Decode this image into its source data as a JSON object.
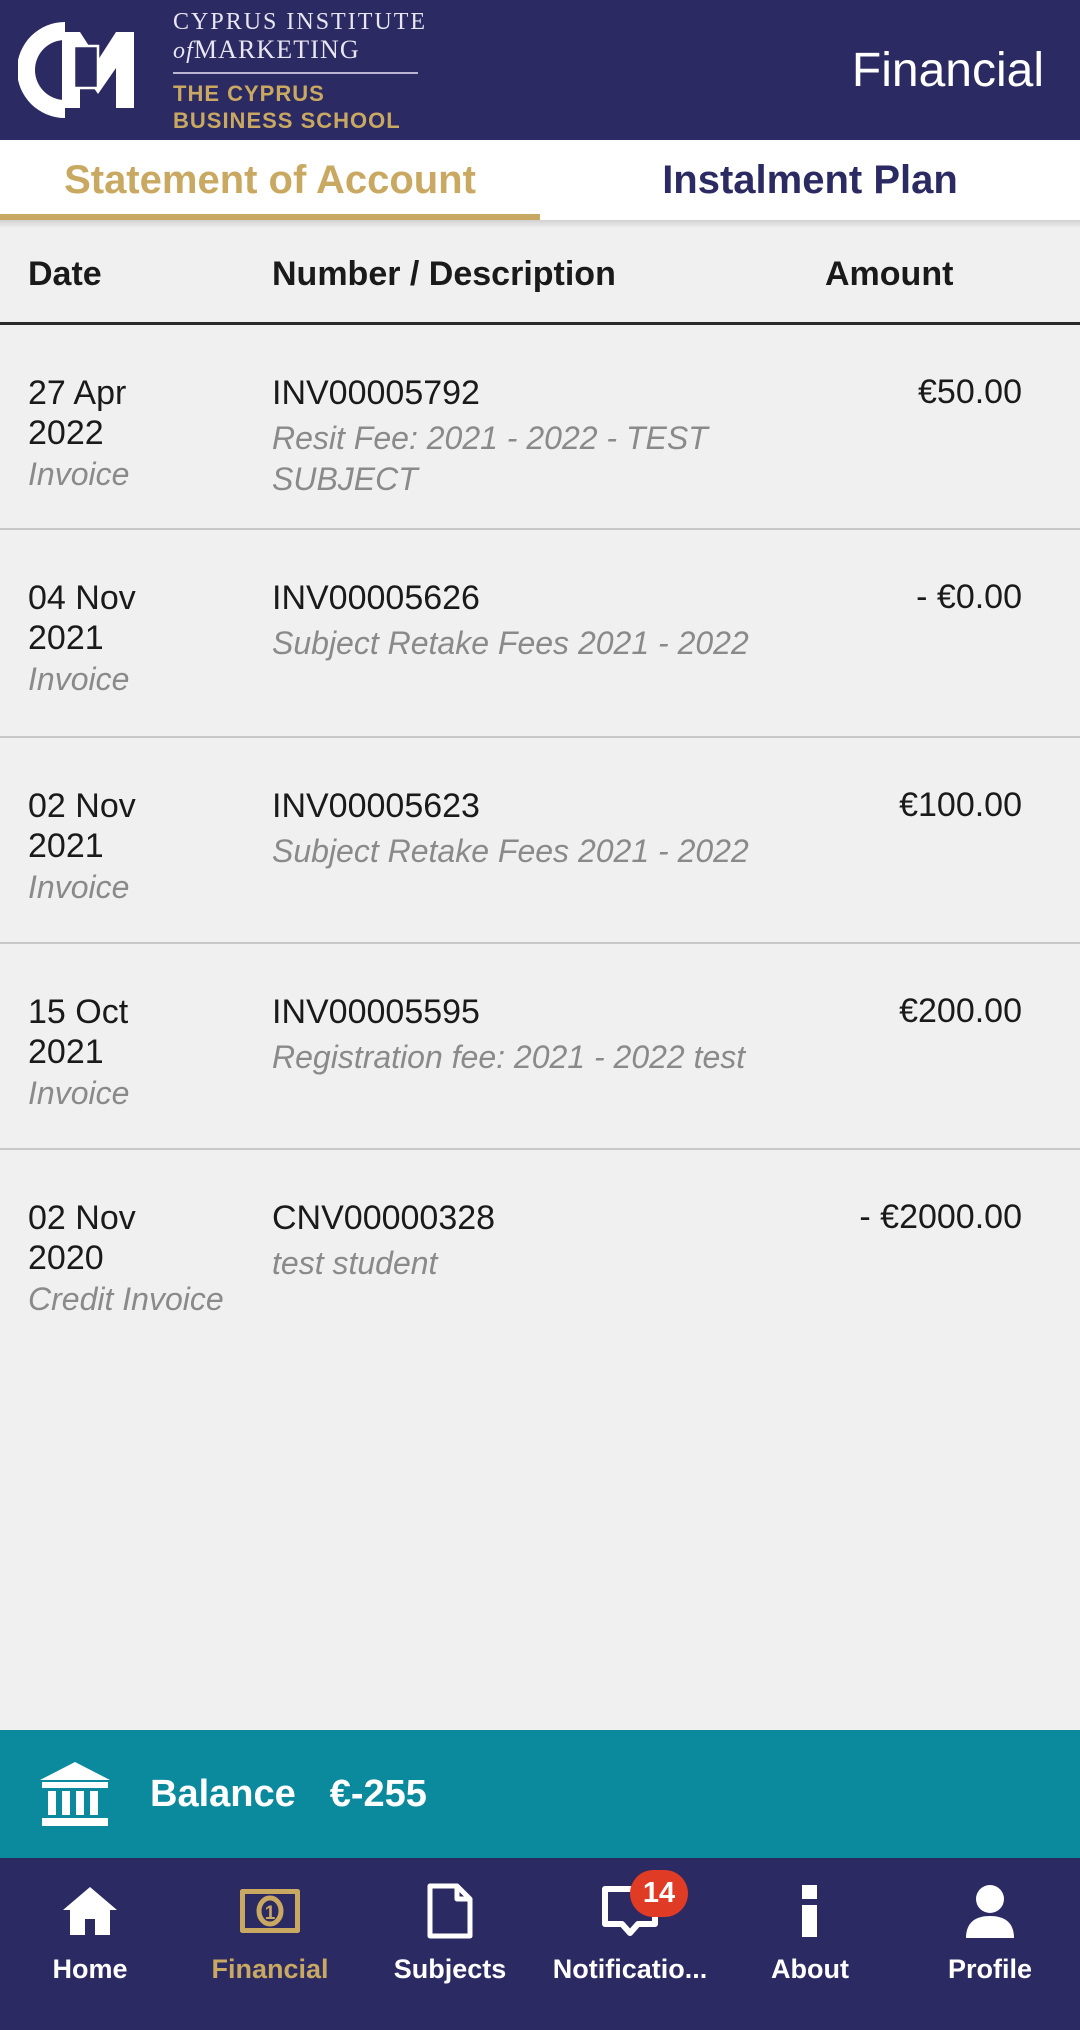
{
  "header": {
    "title": "Financial",
    "logo": {
      "monogram": "cim-monogram",
      "line1": "CYPRUS INSTITUTE",
      "line2_italic": "of",
      "line2": "MARKETING",
      "line3a": "THE CYPRUS",
      "line3b": "BUSINESS SCHOOL"
    },
    "bg_color": "#2c2a62"
  },
  "tabs": {
    "items": [
      {
        "label": "Statement of Account",
        "active": true
      },
      {
        "label": "Instalment Plan",
        "active": false
      }
    ],
    "active_color": "#c9a961",
    "inactive_color": "#2c2a62"
  },
  "table": {
    "columns": [
      "Date",
      "Number / Description",
      "Amount"
    ],
    "rows": [
      {
        "date": "27 Apr\n2022",
        "type": "Invoice",
        "number": "INV00005792",
        "description": "Resit Fee: 2021 - 2022 - TEST SUBJECT",
        "amount": "€50.00"
      },
      {
        "date": "04 Nov\n2021",
        "type": "Invoice",
        "number": "INV00005626",
        "description": "Subject Retake Fees 2021 - 2022",
        "amount": "- €0.00"
      },
      {
        "date": "02 Nov\n2021",
        "type": "Invoice",
        "number": "INV00005623",
        "description": "Subject Retake Fees 2021 - 2022",
        "amount": "€100.00"
      },
      {
        "date": "15 Oct\n2021",
        "type": "Invoice",
        "number": "INV00005595",
        "description": "Registration fee: 2021 - 2022 test",
        "amount": "€200.00"
      },
      {
        "date": "02 Nov\n2020",
        "type": "Credit Invoice",
        "number": "CNV00000328",
        "description": "test student",
        "amount": "- €2000.00"
      }
    ]
  },
  "balance": {
    "icon": "bank-icon",
    "label": "Balance",
    "value": "€-255",
    "bg_color": "#0b8a9e"
  },
  "nav": {
    "items": [
      {
        "label": "Home",
        "icon": "home-icon",
        "active": false
      },
      {
        "label": "Financial",
        "icon": "banknote-icon",
        "active": true
      },
      {
        "label": "Subjects",
        "icon": "document-icon",
        "active": false
      },
      {
        "label": "Notificatio...",
        "icon": "message-icon",
        "active": false,
        "badge": "14"
      },
      {
        "label": "About",
        "icon": "info-icon",
        "active": false
      },
      {
        "label": "Profile",
        "icon": "person-icon",
        "active": false
      }
    ],
    "bg_color": "#2c2a62",
    "active_color": "#c9a961",
    "badge_color": "#e03b24"
  }
}
